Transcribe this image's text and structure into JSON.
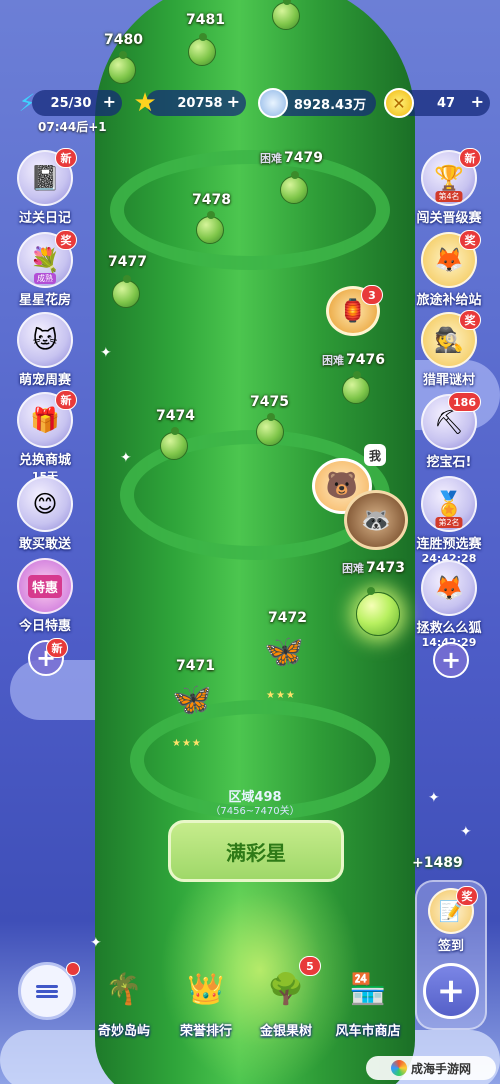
{
  "hud": {
    "energy": "25/30",
    "energy_timer": "07:44后+1",
    "stars": "20758",
    "coins": "8928.43万",
    "tokens": "47"
  },
  "left_menu": [
    {
      "label": "过关日记",
      "badge": "新",
      "icon": "diary-icon"
    },
    {
      "label": "星星花房",
      "badge": "奖",
      "icon": "flower-house-icon",
      "tag": "成熟"
    },
    {
      "label": "萌宠周赛",
      "badge": "",
      "icon": "cat-pet-icon"
    },
    {
      "label": "兑换商城",
      "badge": "新",
      "icon": "shop-icon",
      "sub": "15天"
    },
    {
      "label": "敢买敢送",
      "badge": "",
      "icon": "gift-icon"
    },
    {
      "label": "今日特惠",
      "badge": "",
      "icon": "special-offer-icon",
      "tag": "特惠"
    }
  ],
  "left_add_badge": "新",
  "right_menu": [
    {
      "label": "闯关晋级赛",
      "badge": "新",
      "icon": "trophy-icon",
      "tag": "第4名"
    },
    {
      "label": "旅途补给站",
      "badge": "奖",
      "icon": "supply-icon"
    },
    {
      "label": "猎罪谜村",
      "badge": "奖",
      "icon": "detective-icon"
    },
    {
      "label": "挖宝石!",
      "badge": "186",
      "icon": "dig-gem-icon"
    },
    {
      "label": "连胜预选赛",
      "badge": "",
      "icon": "streak-trophy-icon",
      "tag": "第2名",
      "sub": "24:42:28"
    },
    {
      "label": "拯救么么狐",
      "badge": "",
      "icon": "fox-icon",
      "sub": "14:42:29"
    }
  ],
  "levels": {
    "l7481": "7481",
    "l7480": "7480",
    "l7479": "7479",
    "l7478": "7478",
    "l7477": "7477",
    "l7476": "7476",
    "l7475": "7475",
    "l7474": "7474",
    "l7473": "7473",
    "l7472": "7472",
    "l7471": "7471",
    "hard": "困难"
  },
  "chest_badge": "3",
  "chat_bubble": "我",
  "region": {
    "label": "区域498",
    "range": "（7456~7470关）",
    "name": "满彩星"
  },
  "bonus": "+1489",
  "checkin": {
    "label": "签到",
    "badge": "奖"
  },
  "bottom_nav": [
    {
      "label": "奇妙岛屿",
      "icon": "island-icon",
      "badge": ""
    },
    {
      "label": "荣誉排行",
      "icon": "crown-rank-icon",
      "badge": ""
    },
    {
      "label": "金银果树",
      "icon": "fruit-tree-icon",
      "badge": "5"
    },
    {
      "label": "风车市商店",
      "icon": "windmill-shop-icon",
      "badge": ""
    }
  ],
  "watermark": "成海手游网"
}
